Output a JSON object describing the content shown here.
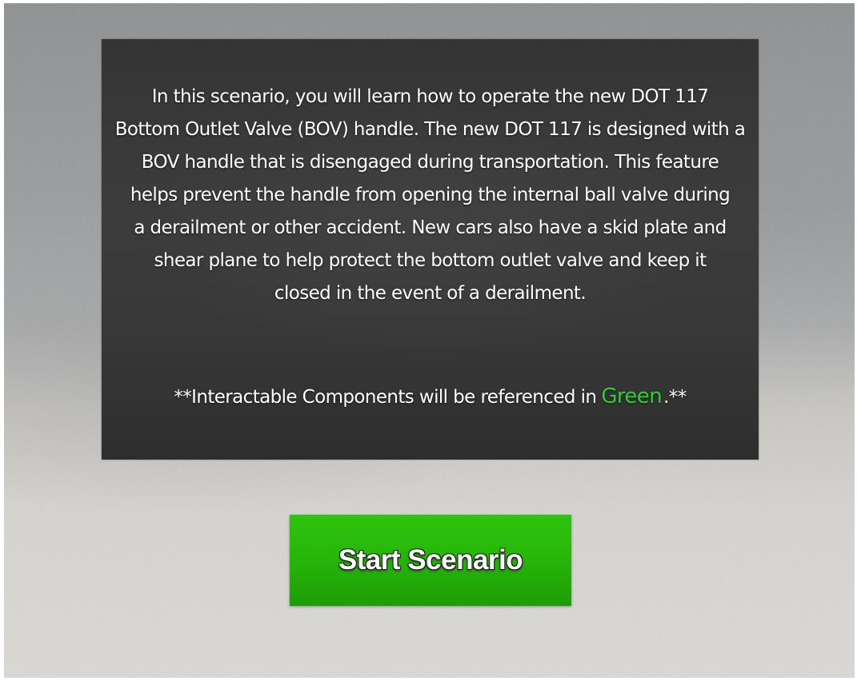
{
  "intro": {
    "lines": [
      "In this scenario, you will learn how to operate the new DOT 117",
      "Bottom Outlet Valve (BOV) handle. The new DOT 117 is designed with a",
      "BOV handle that is disengaged during transportation.  This feature",
      "helps prevent the handle from opening the internal ball valve during",
      "a derailment or other accident.  New cars also have a skid plate and",
      "shear plane to help protect the bottom outlet valve and keep it",
      "closed in the event of a derailment."
    ],
    "note_prefix": "**Interactable Components will be referenced in",
    "note_highlight": "Green",
    "note_suffix": ".**"
  },
  "start_button": {
    "label": "Start Scenario"
  },
  "colors": {
    "highlight_green": "#2dd12d",
    "button_green": "#27b50a",
    "panel": "#383838"
  }
}
